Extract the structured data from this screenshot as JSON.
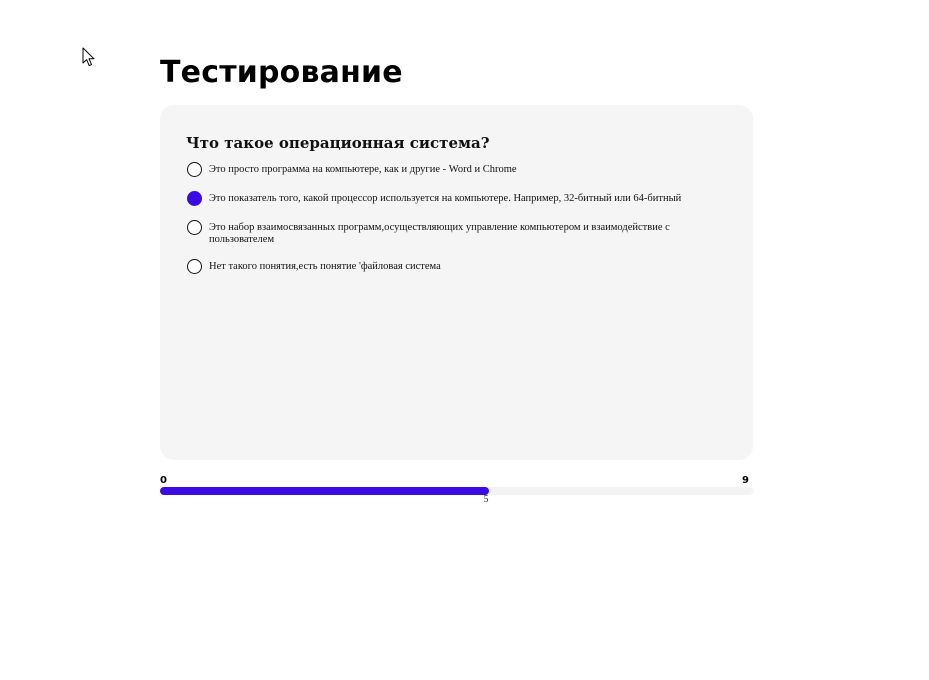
{
  "page": {
    "title": "Тестирование"
  },
  "quiz": {
    "question": "Что такое операционная система?",
    "options": [
      {
        "label": "Это просто программа на компьютере, как и другие - Word и Chrome",
        "selected": false
      },
      {
        "label": "Это показатель того, какой процессор используется на компьютере. Например, 32-битный или 64-битный",
        "selected": true
      },
      {
        "label": "Это набор взаимосвязанных программ,осуществляющих управление компьютером и взаимодействие с пользователем",
        "selected": false
      },
      {
        "label": "Нет такого понятия,есть понятие 'файловая система",
        "selected": false
      }
    ]
  },
  "progress": {
    "min": "0",
    "max": "9",
    "value": "5",
    "fraction": 0.5556
  },
  "colors": {
    "accent": "#3a0ce3",
    "card_background": "#f5f5f5",
    "track_background": "#f3f3f3"
  },
  "icons": {
    "cursor": "mouse-pointer-icon"
  }
}
